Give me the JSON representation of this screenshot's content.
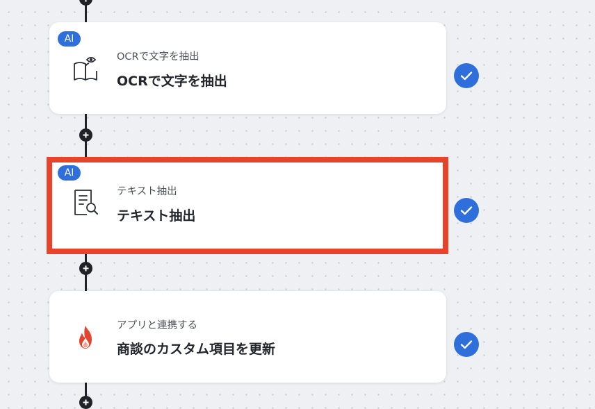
{
  "workflow": {
    "steps": [
      {
        "badge": "AI",
        "icon": "book-eye-icon",
        "subtitle": "OCRで文字を抽出",
        "title": "OCRで文字を抽出",
        "status": "completed"
      },
      {
        "badge": "AI",
        "icon": "document-search-icon",
        "subtitle": "テキスト抽出",
        "title": "テキスト抽出",
        "status": "completed",
        "highlighted": true
      },
      {
        "icon": "flame-app-icon",
        "subtitle": "アプリと連携する",
        "title": "商談のカスタム項目を更新",
        "status": "completed"
      }
    ]
  },
  "colors": {
    "accent": "#2f6fdc",
    "highlight": "#e8442c",
    "connector": "#1f2329",
    "background": "#eef0f3"
  }
}
